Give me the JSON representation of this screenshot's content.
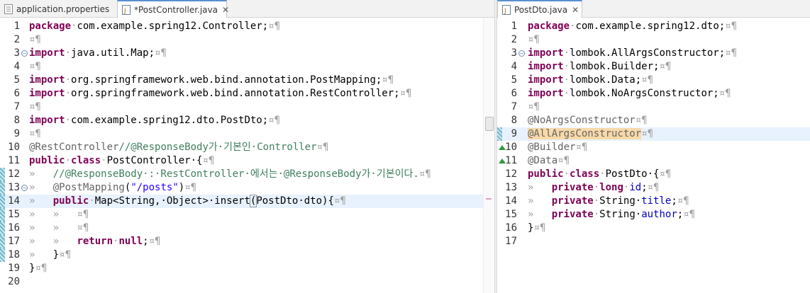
{
  "left_editor": {
    "tabs": [
      {
        "label": "application.properties",
        "active": false,
        "closable": false
      },
      {
        "label": "*PostController.java",
        "active": true,
        "closable": true
      }
    ],
    "lines": [
      {
        "n": "1",
        "t": [
          [
            "kw",
            "package"
          ],
          [
            "ws",
            "·"
          ],
          [
            "",
            "com.example.spring12.Controller;"
          ],
          [
            "ws",
            "¤¶"
          ]
        ]
      },
      {
        "n": "2",
        "t": [
          [
            "ws",
            "¤¶"
          ]
        ]
      },
      {
        "n": "3",
        "fold": "−",
        "t": [
          [
            "kw",
            "import"
          ],
          [
            "ws",
            "·"
          ],
          [
            "",
            "java.util.Map;"
          ],
          [
            "ws",
            "¤¶"
          ]
        ]
      },
      {
        "n": "4",
        "t": [
          [
            "ws",
            "¤¶"
          ]
        ]
      },
      {
        "n": "5",
        "t": [
          [
            "kw",
            "import"
          ],
          [
            "ws",
            "·"
          ],
          [
            "",
            "org.springframework.web.bind.annotation.PostMapping;"
          ],
          [
            "ws",
            "¤¶"
          ]
        ]
      },
      {
        "n": "6",
        "t": [
          [
            "kw",
            "import"
          ],
          [
            "ws",
            "·"
          ],
          [
            "",
            "org.springframework.web.bind.annotation.RestController;"
          ],
          [
            "ws",
            "¤¶"
          ]
        ]
      },
      {
        "n": "7",
        "t": [
          [
            "ws",
            "¤¶"
          ]
        ]
      },
      {
        "n": "8",
        "t": [
          [
            "kw",
            "import"
          ],
          [
            "ws",
            "·"
          ],
          [
            "",
            "com.example.spring12.dto.PostDto;"
          ],
          [
            "ws",
            "¤¶"
          ]
        ]
      },
      {
        "n": "9",
        "t": [
          [
            "ws",
            "¤¶"
          ]
        ]
      },
      {
        "n": "10",
        "t": [
          [
            "ann",
            "@RestController"
          ],
          [
            "cmt",
            "//@ResponseBody가·기본인·Controller"
          ],
          [
            "ws",
            "¤¶"
          ]
        ]
      },
      {
        "n": "11",
        "t": [
          [
            "kw",
            "public"
          ],
          [
            "ws",
            "·"
          ],
          [
            "kw",
            "class"
          ],
          [
            "ws",
            "·"
          ],
          [
            "",
            "PostController·{"
          ],
          [
            "ws",
            "¤¶"
          ]
        ]
      },
      {
        "n": "12",
        "mark": true,
        "t": [
          [
            "ws",
            "»   "
          ],
          [
            "cmt",
            "//@ResponseBody·:·RestController·에서는·@ResponseBody가·기본이다."
          ],
          [
            "ws",
            "¤¶"
          ]
        ]
      },
      {
        "n": "13",
        "mark": true,
        "fold": "−",
        "t": [
          [
            "ws",
            "»   "
          ],
          [
            "ann",
            "@PostMapping"
          ],
          [
            "",
            "("
          ],
          [
            "str",
            "\"/posts\""
          ],
          [
            "",
            ")"
          ],
          [
            "ws",
            "¤¶"
          ]
        ]
      },
      {
        "n": "14",
        "mark": true,
        "current": true,
        "t": [
          [
            "ws",
            "»   "
          ],
          [
            "kw",
            "public"
          ],
          [
            "ws",
            "·"
          ],
          [
            "",
            "Map<String,·Object>·insert"
          ],
          [
            "br",
            "("
          ],
          [
            "",
            "PostDto·dto){"
          ],
          [
            "ws",
            "¤¶"
          ]
        ]
      },
      {
        "n": "15",
        "mark": true,
        "t": [
          [
            "ws",
            "»   »   ¤¶"
          ]
        ]
      },
      {
        "n": "16",
        "mark": true,
        "t": [
          [
            "ws",
            "»   »   ¤¶"
          ]
        ]
      },
      {
        "n": "17",
        "mark": true,
        "t": [
          [
            "ws",
            "»   »   "
          ],
          [
            "kw",
            "return"
          ],
          [
            "ws",
            "·"
          ],
          [
            "kw",
            "null"
          ],
          [
            "",
            ";"
          ],
          [
            "ws",
            "¤¶"
          ]
        ]
      },
      {
        "n": "18",
        "mark": true,
        "t": [
          [
            "ws",
            "»   "
          ],
          [
            "",
            "}"
          ],
          [
            "ws",
            "¤¶"
          ]
        ]
      },
      {
        "n": "19",
        "t": [
          [
            "",
            "}"
          ],
          [
            "ws",
            "¤¶"
          ]
        ]
      },
      {
        "n": "20",
        "t": []
      }
    ]
  },
  "right_editor": {
    "tabs": [
      {
        "label": "PostDto.java",
        "active": true,
        "closable": true
      }
    ],
    "lines": [
      {
        "n": "1",
        "t": [
          [
            "kw",
            "package"
          ],
          [
            "ws",
            "·"
          ],
          [
            "",
            "com.example.spring12.dto;"
          ],
          [
            "ws",
            "¤¶"
          ]
        ]
      },
      {
        "n": "2",
        "t": [
          [
            "ws",
            "¤¶"
          ]
        ]
      },
      {
        "n": "3",
        "fold": "−",
        "t": [
          [
            "kw",
            "import"
          ],
          [
            "ws",
            "·"
          ],
          [
            "",
            "lombok.AllArgsConstructor;"
          ],
          [
            "ws",
            "¤¶"
          ]
        ]
      },
      {
        "n": "4",
        "t": [
          [
            "kw",
            "import"
          ],
          [
            "ws",
            "·"
          ],
          [
            "",
            "lombok.Builder;"
          ],
          [
            "ws",
            "¤¶"
          ]
        ]
      },
      {
        "n": "5",
        "t": [
          [
            "kw",
            "import"
          ],
          [
            "ws",
            "·"
          ],
          [
            "",
            "lombok.Data;"
          ],
          [
            "ws",
            "¤¶"
          ]
        ]
      },
      {
        "n": "6",
        "t": [
          [
            "kw",
            "import"
          ],
          [
            "ws",
            "·"
          ],
          [
            "",
            "lombok.NoArgsConstructor;"
          ],
          [
            "ws",
            "¤¶"
          ]
        ]
      },
      {
        "n": "7",
        "t": [
          [
            "ws",
            "¤¶"
          ]
        ]
      },
      {
        "n": "8",
        "t": [
          [
            "ann",
            "@NoArgsConstructor"
          ],
          [
            "ws",
            "¤¶"
          ]
        ]
      },
      {
        "n": "9",
        "mark": true,
        "current": true,
        "t": [
          [
            "annhl",
            "@AllArgsConstructor"
          ],
          [
            "ws",
            "¤¶"
          ]
        ]
      },
      {
        "n": "10",
        "tri": true,
        "t": [
          [
            "ann",
            "@Builder"
          ],
          [
            "ws",
            "¤¶"
          ]
        ]
      },
      {
        "n": "11",
        "tri": true,
        "t": [
          [
            "ann",
            "@Data"
          ],
          [
            "ws",
            "¤¶"
          ]
        ]
      },
      {
        "n": "12",
        "t": [
          [
            "kw",
            "public"
          ],
          [
            "ws",
            "·"
          ],
          [
            "kw",
            "class"
          ],
          [
            "ws",
            "·"
          ],
          [
            "",
            "PostDto·{"
          ],
          [
            "ws",
            "¤¶"
          ]
        ]
      },
      {
        "n": "13",
        "t": [
          [
            "ws",
            "»   "
          ],
          [
            "kw",
            "private"
          ],
          [
            "ws",
            "·"
          ],
          [
            "kw",
            "long"
          ],
          [
            "ws",
            "·"
          ],
          [
            "fld",
            "id"
          ],
          [
            "",
            ";"
          ],
          [
            "ws",
            "¤¶"
          ]
        ]
      },
      {
        "n": "14",
        "t": [
          [
            "ws",
            "»   "
          ],
          [
            "kw",
            "private"
          ],
          [
            "ws",
            "·"
          ],
          [
            "",
            "String·"
          ],
          [
            "fld",
            "title"
          ],
          [
            "",
            ";"
          ],
          [
            "ws",
            "¤¶"
          ]
        ]
      },
      {
        "n": "15",
        "t": [
          [
            "ws",
            "»   "
          ],
          [
            "kw",
            "private"
          ],
          [
            "ws",
            "·"
          ],
          [
            "",
            "String·"
          ],
          [
            "fld",
            "author"
          ],
          [
            "",
            ";"
          ],
          [
            "ws",
            "¤¶"
          ]
        ]
      },
      {
        "n": "16",
        "t": [
          [
            "",
            "}"
          ],
          [
            "ws",
            "¤¶"
          ]
        ]
      },
      {
        "n": "17",
        "t": []
      }
    ]
  }
}
